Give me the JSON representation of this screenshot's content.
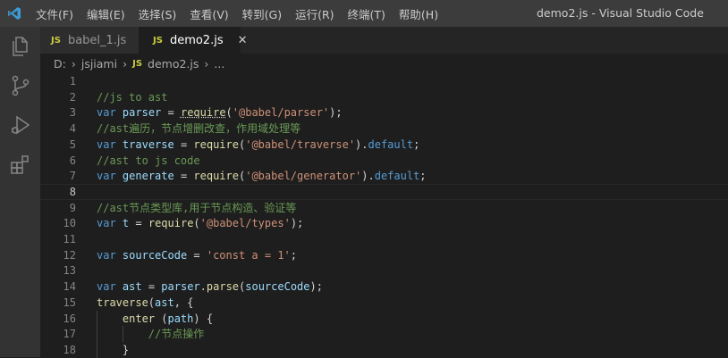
{
  "titlebar": {
    "menu": [
      "文件(F)",
      "编辑(E)",
      "选择(S)",
      "查看(V)",
      "转到(G)",
      "运行(R)",
      "终端(T)",
      "帮助(H)"
    ],
    "window_title": "demo2.js - Visual Studio Code"
  },
  "activity_bar": {
    "icons": [
      "explorer-icon",
      "source-control-icon",
      "run-debug-icon",
      "extensions-icon"
    ]
  },
  "tabs": [
    {
      "badge": "JS",
      "label": "babel_1.js",
      "active": false
    },
    {
      "badge": "JS",
      "label": "demo2.js",
      "active": true,
      "close": "✕"
    }
  ],
  "breadcrumb": {
    "drive": "D:",
    "folder": "jsjiami",
    "badge": "JS",
    "file": "demo2.js",
    "more": "..."
  },
  "editor": {
    "current_line": 8,
    "lines": [
      {
        "n": "1",
        "segments": []
      },
      {
        "n": "2",
        "segments": [
          {
            "c": "cm",
            "t": "//js to ast"
          }
        ]
      },
      {
        "n": "3",
        "segments": [
          {
            "c": "kw",
            "t": "var"
          },
          {
            "c": "",
            "t": " "
          },
          {
            "c": "var",
            "t": "parser"
          },
          {
            "c": "",
            "t": " = "
          },
          {
            "c": "req",
            "t": "require"
          },
          {
            "c": "",
            "t": "("
          },
          {
            "c": "str",
            "t": "'@babel/parser'"
          },
          {
            "c": "",
            "t": ");"
          }
        ]
      },
      {
        "n": "4",
        "segments": [
          {
            "c": "cm",
            "t": "//ast遍历，节点增删改查，作用域处理等"
          }
        ]
      },
      {
        "n": "5",
        "segments": [
          {
            "c": "kw",
            "t": "var"
          },
          {
            "c": "",
            "t": " "
          },
          {
            "c": "var",
            "t": "traverse"
          },
          {
            "c": "",
            "t": " = "
          },
          {
            "c": "fn",
            "t": "require"
          },
          {
            "c": "",
            "t": "("
          },
          {
            "c": "str",
            "t": "'@babel/traverse'"
          },
          {
            "c": "",
            "t": ")."
          },
          {
            "c": "kw",
            "t": "default"
          },
          {
            "c": "",
            "t": ";"
          }
        ]
      },
      {
        "n": "6",
        "segments": [
          {
            "c": "cm",
            "t": "//ast to js code"
          }
        ]
      },
      {
        "n": "7",
        "segments": [
          {
            "c": "kw",
            "t": "var"
          },
          {
            "c": "",
            "t": " "
          },
          {
            "c": "var",
            "t": "generate"
          },
          {
            "c": "",
            "t": " = "
          },
          {
            "c": "fn",
            "t": "require"
          },
          {
            "c": "",
            "t": "("
          },
          {
            "c": "str",
            "t": "'@babel/generator'"
          },
          {
            "c": "",
            "t": ")."
          },
          {
            "c": "kw",
            "t": "default"
          },
          {
            "c": "",
            "t": ";"
          }
        ]
      },
      {
        "n": "8",
        "segments": []
      },
      {
        "n": "9",
        "segments": [
          {
            "c": "cm",
            "t": "//ast节点类型库,用于节点构造、验证等"
          }
        ]
      },
      {
        "n": "10",
        "segments": [
          {
            "c": "kw",
            "t": "var"
          },
          {
            "c": "",
            "t": " "
          },
          {
            "c": "var",
            "t": "t"
          },
          {
            "c": "",
            "t": " = "
          },
          {
            "c": "fn",
            "t": "require"
          },
          {
            "c": "",
            "t": "("
          },
          {
            "c": "str",
            "t": "'@babel/types'"
          },
          {
            "c": "",
            "t": ");"
          }
        ]
      },
      {
        "n": "11",
        "segments": []
      },
      {
        "n": "12",
        "segments": [
          {
            "c": "kw",
            "t": "var"
          },
          {
            "c": "",
            "t": " "
          },
          {
            "c": "var",
            "t": "sourceCode"
          },
          {
            "c": "",
            "t": " = "
          },
          {
            "c": "str",
            "t": "'const a = 1'"
          },
          {
            "c": "",
            "t": ";"
          }
        ]
      },
      {
        "n": "13",
        "segments": []
      },
      {
        "n": "14",
        "segments": [
          {
            "c": "kw",
            "t": "var"
          },
          {
            "c": "",
            "t": " "
          },
          {
            "c": "var",
            "t": "ast"
          },
          {
            "c": "",
            "t": " = "
          },
          {
            "c": "var",
            "t": "parser"
          },
          {
            "c": "",
            "t": "."
          },
          {
            "c": "fn",
            "t": "parse"
          },
          {
            "c": "",
            "t": "("
          },
          {
            "c": "var",
            "t": "sourceCode"
          },
          {
            "c": "",
            "t": ");"
          }
        ]
      },
      {
        "n": "15",
        "segments": [
          {
            "c": "fn",
            "t": "traverse"
          },
          {
            "c": "",
            "t": "("
          },
          {
            "c": "var",
            "t": "ast"
          },
          {
            "c": "",
            "t": ", {"
          }
        ]
      },
      {
        "n": "16",
        "segments": [
          {
            "c": "",
            "t": "    "
          },
          {
            "c": "fn",
            "t": "enter"
          },
          {
            "c": "",
            "t": " ("
          },
          {
            "c": "var",
            "t": "path"
          },
          {
            "c": "",
            "t": ") {"
          }
        ]
      },
      {
        "n": "17",
        "segments": [
          {
            "c": "",
            "t": "        "
          },
          {
            "c": "cm",
            "t": "//节点操作"
          }
        ]
      },
      {
        "n": "18",
        "segments": [
          {
            "c": "",
            "t": "    }"
          }
        ]
      }
    ]
  }
}
